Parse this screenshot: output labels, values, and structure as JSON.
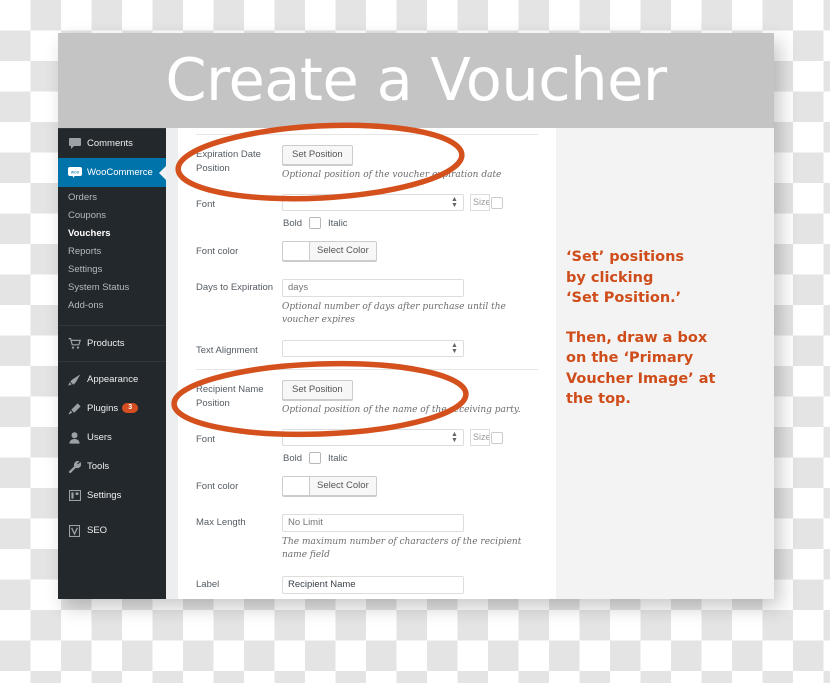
{
  "window": {
    "title": "Create a Voucher"
  },
  "sidebar": {
    "items": [
      {
        "label": "Comments",
        "icon": "comment-icon",
        "badge": null,
        "active": false
      },
      {
        "label": "WooCommerce",
        "icon": "woocommerce-icon",
        "badge": null,
        "active": true
      },
      {
        "label": "Products",
        "icon": "cart-icon",
        "badge": null,
        "active": false
      },
      {
        "label": "Appearance",
        "icon": "brush-icon",
        "badge": null,
        "active": false
      },
      {
        "label": "Plugins",
        "icon": "plug-icon",
        "badge": "3",
        "active": false
      },
      {
        "label": "Users",
        "icon": "user-icon",
        "badge": null,
        "active": false
      },
      {
        "label": "Tools",
        "icon": "wrench-icon",
        "badge": null,
        "active": false
      },
      {
        "label": "Settings",
        "icon": "sliders-icon",
        "badge": null,
        "active": false
      },
      {
        "label": "SEO",
        "icon": "seo-icon",
        "badge": null,
        "active": false
      }
    ],
    "submenu": [
      {
        "label": "Orders",
        "current": false
      },
      {
        "label": "Coupons",
        "current": false
      },
      {
        "label": "Vouchers",
        "current": true
      },
      {
        "label": "Reports",
        "current": false
      },
      {
        "label": "Settings",
        "current": false
      },
      {
        "label": "System Status",
        "current": false
      },
      {
        "label": "Add-ons",
        "current": false
      }
    ]
  },
  "form": {
    "expiration": {
      "label": "Expiration Date Position",
      "button": "Set Position",
      "description": "Optional position of the voucher expiration date",
      "font_label": "Font",
      "size_label": "Size",
      "bold_label": "Bold",
      "italic_label": "Italic",
      "font_color_label": "Font color",
      "select_color_button": "Select Color",
      "days_label": "Days to Expiration",
      "days_placeholder": "days",
      "days_description": "Optional number of days after purchase until the voucher expires",
      "text_alignment_label": "Text Alignment"
    },
    "recipient": {
      "label": "Recipient Name Position",
      "button": "Set Position",
      "description": "Optional position of the name of the receiving party.",
      "font_label": "Font",
      "size_label": "Size",
      "bold_label": "Bold",
      "italic_label": "Italic",
      "font_color_label": "Font color",
      "select_color_button": "Select Color",
      "max_length_label": "Max Length",
      "max_length_placeholder": "No Limit",
      "max_length_description": "The maximum number of characters of the recipient name field",
      "field_label": "Label",
      "field_value": "Recipient Name"
    }
  },
  "annotation": {
    "line1": "‘Set’ positions",
    "line2": "by clicking",
    "line3": "‘Set Position.’",
    "line4": "Then, draw a box",
    "line5": "on the ‘Primary",
    "line6": "Voucher Image’ at",
    "line7": "the top."
  },
  "colors": {
    "annotation_orange": "#cf4d1a",
    "circle_orange": "#d4501c",
    "sidebar_dark": "#23282d",
    "active_blue": "#0073aa",
    "titlebar_gray": "#c4c4c4",
    "badge_orange": "#d54e21"
  }
}
